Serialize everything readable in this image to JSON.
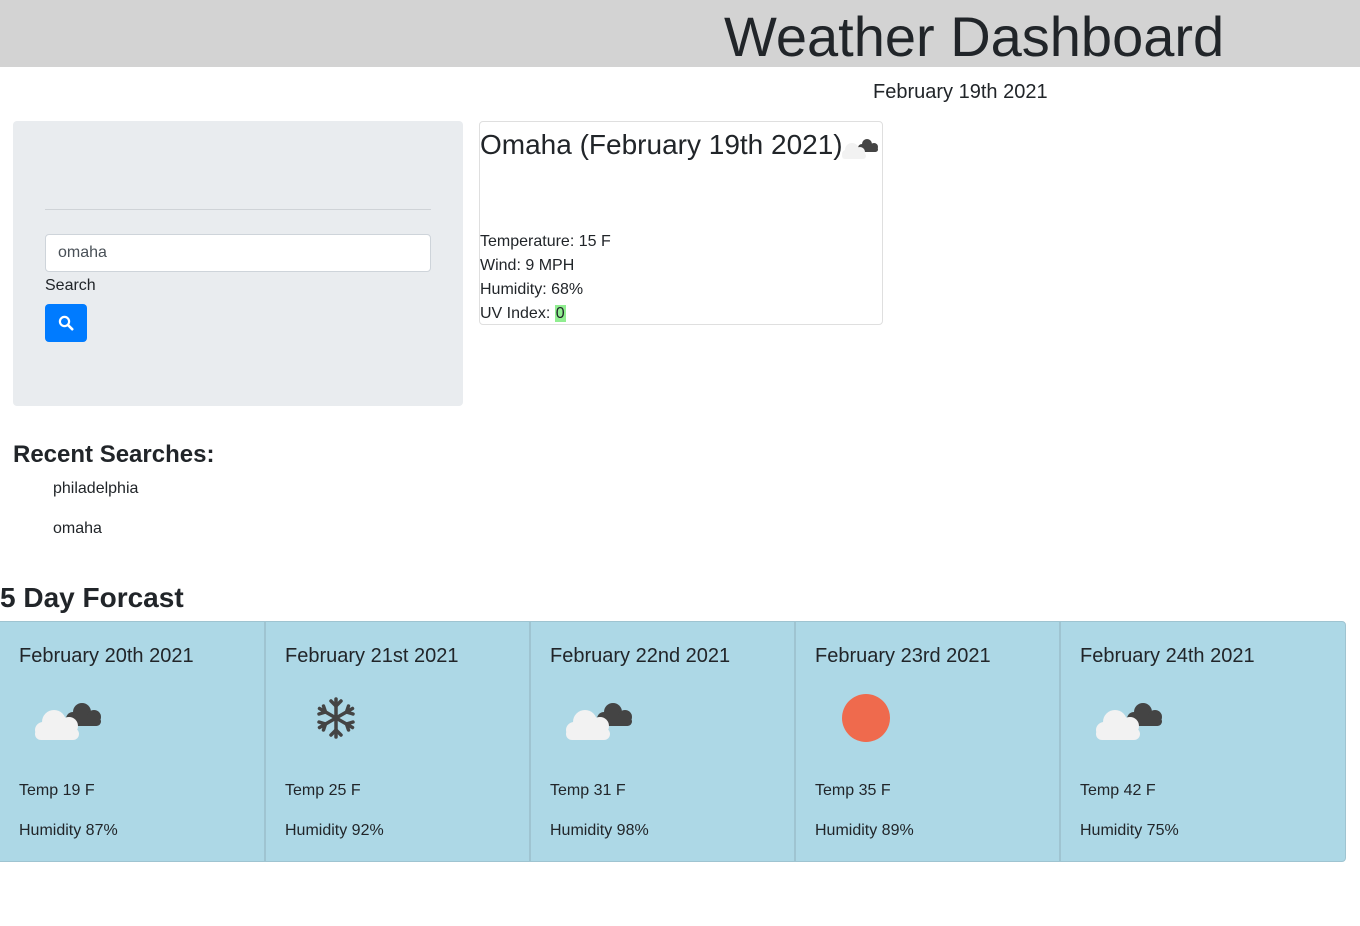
{
  "header": {
    "title": "Weather Dashboard"
  },
  "current_date": "February 19th 2021",
  "search": {
    "value": "omaha",
    "label": "Search",
    "button_icon": "search-icon",
    "button_color": "#007bff"
  },
  "current": {
    "city_heading": "Omaha (February 19th 2021)",
    "icon": "cloudy-icon",
    "temperature": "Temperature: 15 F",
    "wind": "Wind: 9 MPH",
    "humidity": "Humidity: 68%",
    "uv_label": "UV Index: ",
    "uv_value": "0",
    "uv_color": "#90ee90"
  },
  "recent": {
    "title": "Recent Searches:",
    "items": [
      "philadelphia",
      "omaha"
    ]
  },
  "forecast": {
    "title": "5 Day Forcast",
    "card_color": "#add8e6",
    "days": [
      {
        "date": "February 20th 2021",
        "icon": "cloudy-icon",
        "temp": "Temp 19 F",
        "humidity": "Humidity 87%"
      },
      {
        "date": "February 21st 2021",
        "icon": "snowflake-icon",
        "temp": "Temp 25 F",
        "humidity": "Humidity 92%"
      },
      {
        "date": "February 22nd 2021",
        "icon": "cloudy-icon",
        "temp": "Temp 31 F",
        "humidity": "Humidity 98%"
      },
      {
        "date": "February 23rd 2021",
        "icon": "sun-icon",
        "temp": "Temp 35 F",
        "humidity": "Humidity 89%"
      },
      {
        "date": "February 24th 2021",
        "icon": "cloudy-icon",
        "temp": "Temp 42 F",
        "humidity": "Humidity 75%"
      }
    ]
  }
}
